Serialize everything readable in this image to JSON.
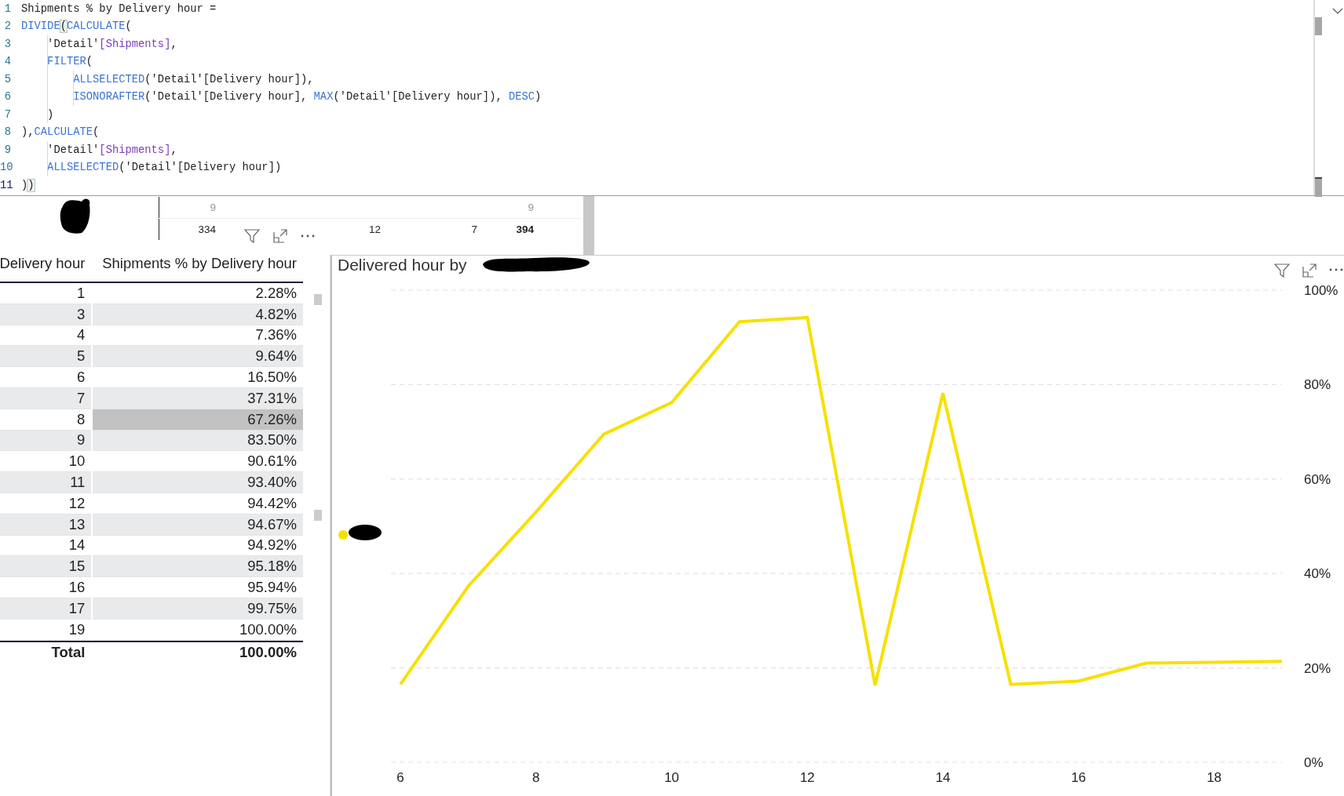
{
  "editor": {
    "lines": [
      {
        "number": "1",
        "current": false,
        "segments": [
          {
            "kind": "text",
            "text": "Shipments % by Delivery hour ="
          }
        ]
      },
      {
        "number": "2",
        "current": false,
        "segments": [
          {
            "kind": "function",
            "text": "DIVIDE"
          },
          {
            "kind": "match",
            "text": "("
          },
          {
            "kind": "function",
            "text": "CALCULATE"
          },
          {
            "kind": "text",
            "text": "("
          }
        ]
      },
      {
        "number": "3",
        "current": false,
        "segments": [
          {
            "kind": "text",
            "text": "    'Detail'"
          },
          {
            "kind": "column",
            "text": "[Shipments]"
          },
          {
            "kind": "text",
            "text": ","
          }
        ]
      },
      {
        "number": "4",
        "current": false,
        "segments": [
          {
            "kind": "function",
            "text": "    FILTER"
          },
          {
            "kind": "text",
            "text": "("
          }
        ]
      },
      {
        "number": "5",
        "current": false,
        "segments": [
          {
            "kind": "function",
            "text": "        ALLSELECTED"
          },
          {
            "kind": "text",
            "text": "('Detail'[Delivery hour]),"
          }
        ]
      },
      {
        "number": "6",
        "current": false,
        "segments": [
          {
            "kind": "function",
            "text": "        ISONORAFTER"
          },
          {
            "kind": "text",
            "text": "('Detail'[Delivery hour], "
          },
          {
            "kind": "function",
            "text": "MAX"
          },
          {
            "kind": "text",
            "text": "('Detail'[Delivery hour]), "
          },
          {
            "kind": "function",
            "text": "DESC"
          },
          {
            "kind": "text",
            "text": ")"
          }
        ]
      },
      {
        "number": "7",
        "current": false,
        "segments": [
          {
            "kind": "text",
            "text": "    )"
          }
        ]
      },
      {
        "number": "8",
        "current": false,
        "segments": [
          {
            "kind": "text",
            "text": "),"
          },
          {
            "kind": "function",
            "text": "CALCULATE"
          },
          {
            "kind": "text",
            "text": "("
          }
        ]
      },
      {
        "number": "9",
        "current": false,
        "segments": [
          {
            "kind": "text",
            "text": "    'Detail'"
          },
          {
            "kind": "column",
            "text": "[Shipments]"
          },
          {
            "kind": "text",
            "text": ","
          }
        ]
      },
      {
        "number": "10",
        "current": false,
        "segments": [
          {
            "kind": "function",
            "text": "    ALLSELECTED"
          },
          {
            "kind": "text",
            "text": "('Detail'[Delivery hour])"
          }
        ]
      },
      {
        "number": "11",
        "current": true,
        "segments": [
          {
            "kind": "text",
            "text": ")"
          },
          {
            "kind": "match",
            "text": ")"
          }
        ]
      }
    ]
  },
  "matrix_strip": {
    "header": {
      "first": "9",
      "last": "9"
    },
    "row": {
      "cells": [
        "334",
        "12",
        "7"
      ],
      "total": "394"
    }
  },
  "table": {
    "columns": [
      "Delivery hour",
      "Shipments % by Delivery hour"
    ],
    "rows": [
      {
        "hour": "1",
        "value": "2.28%",
        "selected": false
      },
      {
        "hour": "3",
        "value": "4.82%",
        "selected": false
      },
      {
        "hour": "4",
        "value": "7.36%",
        "selected": false
      },
      {
        "hour": "5",
        "value": "9.64%",
        "selected": false
      },
      {
        "hour": "6",
        "value": "16.50%",
        "selected": false
      },
      {
        "hour": "7",
        "value": "37.31%",
        "selected": false
      },
      {
        "hour": "8",
        "value": "67.26%",
        "selected": true
      },
      {
        "hour": "9",
        "value": "83.50%",
        "selected": false
      },
      {
        "hour": "10",
        "value": "90.61%",
        "selected": false
      },
      {
        "hour": "11",
        "value": "93.40%",
        "selected": false
      },
      {
        "hour": "12",
        "value": "94.42%",
        "selected": false
      },
      {
        "hour": "13",
        "value": "94.67%",
        "selected": false
      },
      {
        "hour": "14",
        "value": "94.92%",
        "selected": false
      },
      {
        "hour": "15",
        "value": "95.18%",
        "selected": false
      },
      {
        "hour": "16",
        "value": "95.94%",
        "selected": false
      },
      {
        "hour": "17",
        "value": "99.75%",
        "selected": false
      },
      {
        "hour": "19",
        "value": "100.00%",
        "selected": false
      }
    ],
    "total": {
      "label": "Total",
      "value": "100.00%"
    }
  },
  "chart": {
    "title": "Delivered hour by",
    "chart_data": {
      "type": "line",
      "x": [
        6,
        7,
        8,
        9,
        10,
        11,
        12,
        13,
        14,
        15,
        16,
        17,
        18,
        19
      ],
      "series": [
        {
          "color": "#f7e000",
          "values": [
            0.165,
            0.373,
            0.53,
            0.695,
            0.762,
            0.933,
            0.942,
            0.163,
            0.782,
            0.165,
            0.172,
            0.21,
            0.212,
            0.214
          ]
        }
      ],
      "xlim": [
        5.86,
        19
      ],
      "ylim": [
        0,
        1
      ],
      "grid": true,
      "xticks": [
        6,
        8,
        10,
        12,
        14,
        16,
        18
      ],
      "yticks": [
        {
          "value": 0,
          "label": "0%"
        },
        {
          "value": 0.2,
          "label": "20%"
        },
        {
          "value": 0.4,
          "label": "40%"
        },
        {
          "value": 0.6,
          "label": "60%"
        },
        {
          "value": 0.8,
          "label": "80%"
        },
        {
          "value": 1,
          "label": "100%"
        }
      ]
    }
  }
}
